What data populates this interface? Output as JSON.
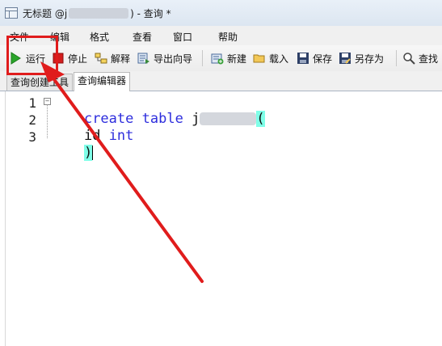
{
  "window": {
    "title_prefix": "无标题 @j",
    "title_suffix": ") - 查询 *"
  },
  "menu": {
    "file": "文件",
    "edit": "编辑",
    "format": "格式",
    "view": "查看",
    "window": "窗口",
    "help": "帮助"
  },
  "toolbar": {
    "run": "运行",
    "stop": "停止",
    "explain": "解释",
    "export_wizard": "导出向导",
    "new": "新建",
    "load": "载入",
    "save": "保存",
    "save_as": "另存为",
    "find": "查找"
  },
  "tabs": {
    "query_builder": "查询创建工具",
    "query_editor": "查询编辑器"
  },
  "editor": {
    "lines": [
      {
        "number": "1",
        "kw1": "create",
        "kw2": "table",
        "after": "j",
        "close": "("
      },
      {
        "number": "2",
        "text": "id",
        "kw": "int"
      },
      {
        "number": "3",
        "close": ")"
      }
    ]
  },
  "colors": {
    "annotation": "#e01c1c",
    "keyword": "#2d2ddd",
    "bracket_match": "#7fffe8"
  },
  "icons": [
    "app-icon",
    "play-icon",
    "stop-icon",
    "explain-icon",
    "export-icon",
    "new-icon",
    "folder-icon",
    "disk-icon",
    "save-as-icon",
    "search-icon"
  ]
}
